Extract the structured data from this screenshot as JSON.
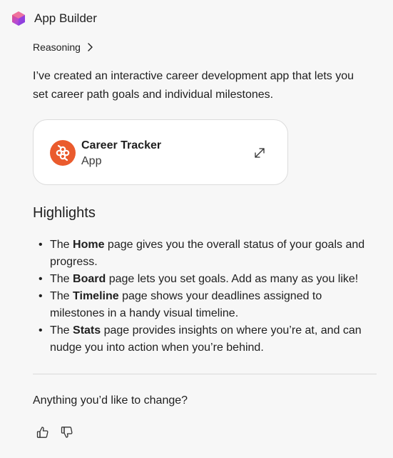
{
  "header": {
    "app_name": "App Builder",
    "logo_icon": "app-builder-logo-icon",
    "logo_colors": [
      "#f0506e",
      "#b44ad6",
      "#7a3fe0"
    ]
  },
  "reasoning": {
    "label": "Reasoning",
    "chevron_icon": "chevron-right-icon"
  },
  "intro_text": "I’ve created an interactive career development app that lets you set career path goals and individual milestones.",
  "card": {
    "title": "Career Tracker",
    "subtitle": "App",
    "icon": "career-tracker-app-icon",
    "icon_color": "#ea5b2d",
    "expand_icon": "expand-icon"
  },
  "highlights": {
    "title": "Highlights",
    "items": [
      {
        "prefix": "The ",
        "bold": "Home",
        "rest": " page gives you the overall status of your goals and progress."
      },
      {
        "prefix": "The ",
        "bold": "Board",
        "rest": " page lets you set goals. Add as many as you like!"
      },
      {
        "prefix": "The ",
        "bold": "Timeline",
        "rest": " page shows your deadlines assigned to milestones in a handy visual timeline."
      },
      {
        "prefix": "The ",
        "bold": "Stats",
        "rest": " page provides insights on where you’re at, and can nudge you into action when you’re behind."
      }
    ]
  },
  "question": "Anything you’d like to change?",
  "feedback": {
    "thumbs_up_icon": "thumbs-up-icon",
    "thumbs_down_icon": "thumbs-down-icon"
  },
  "colors": {
    "background": "#f7f7f7",
    "card_background": "#ffffff",
    "card_border": "#dcdcdc",
    "text": "#1f1f1f"
  }
}
